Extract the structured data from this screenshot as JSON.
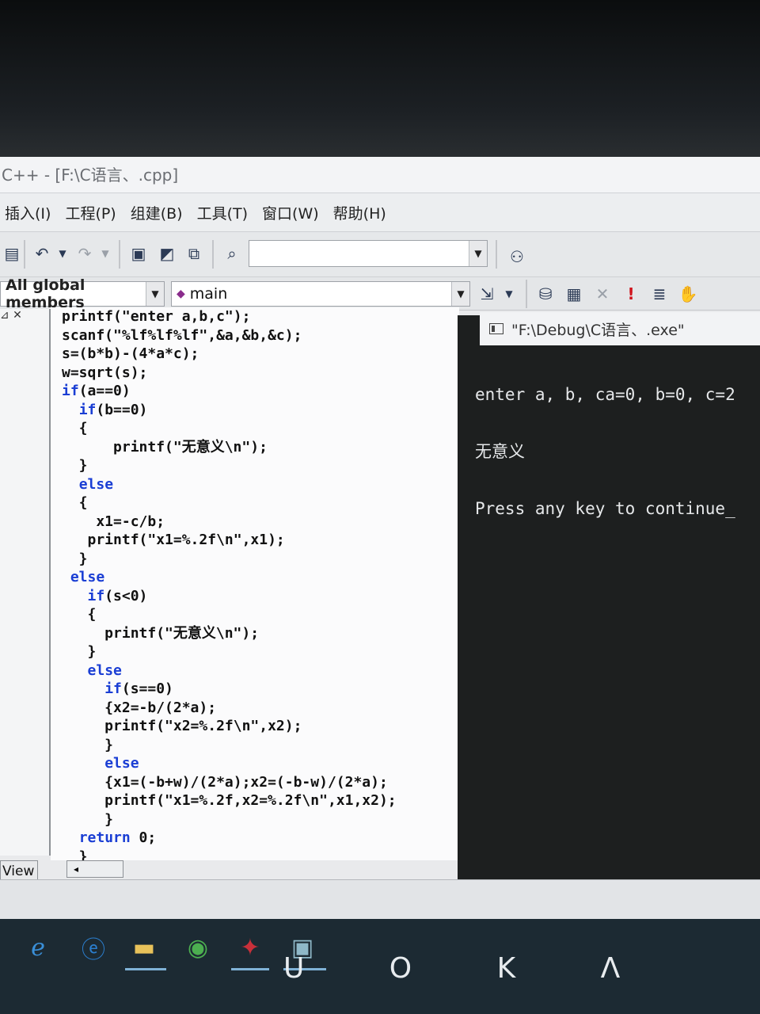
{
  "window": {
    "title": "C++ - [F:\\C语言、.cpp]"
  },
  "menu": [
    "插入(I)",
    "工程(P)",
    "组建(B)",
    "工具(T)",
    "窗口(W)",
    "帮助(H)"
  ],
  "toolbar2": {
    "members_combo": "All global members",
    "function_combo": "main"
  },
  "left_pane": {
    "tab_label": "View"
  },
  "code_lines": [
    "printf(\"enter a,b,c\");",
    "scanf(\"%lf%lf%lf\",&a,&b,&c);",
    "s=(b*b)-(4*a*c);",
    "w=sqrt(s);",
    "if(a==0)",
    "  if(b==0)",
    "  {",
    "      printf(\"无意义\\n\");",
    "  }",
    "  else",
    "  {",
    "    x1=-c/b;",
    "   printf(\"x1=%.2f\\n\",x1);",
    "  }",
    " else",
    "   if(s<0)",
    "   {",
    "     printf(\"无意义\\n\");",
    "   }",
    "   else",
    "     if(s==0)",
    "     {x2=-b/(2*a);",
    "     printf(\"x2=%.2f\\n\",x2);",
    "     }",
    "     else",
    "     {x1=(-b+w)/(2*a);x2=(-b-w)/(2*a);",
    "     printf(\"x1=%.2f,x2=%.2f\\n\",x1,x2);",
    "     }",
    "  return 0;",
    "  }"
  ],
  "console": {
    "title": "\"F:\\Debug\\C语言、.exe\"",
    "lines": [
      "enter a, b, ca=0, b=0, c=2",
      "无意义",
      "Press any key to continue_"
    ]
  },
  "taskbar": {
    "icons": [
      "ie-icon",
      "edge-icon",
      "file-explorer-icon",
      "browser-green-icon",
      "visual-studio-icon",
      "console-app-icon"
    ],
    "keys_text": "U O K Λ"
  },
  "colors": {
    "keyword": "#1a3ed4",
    "console_bg": "#1d1f1f",
    "taskbar": "#1c2a33"
  }
}
